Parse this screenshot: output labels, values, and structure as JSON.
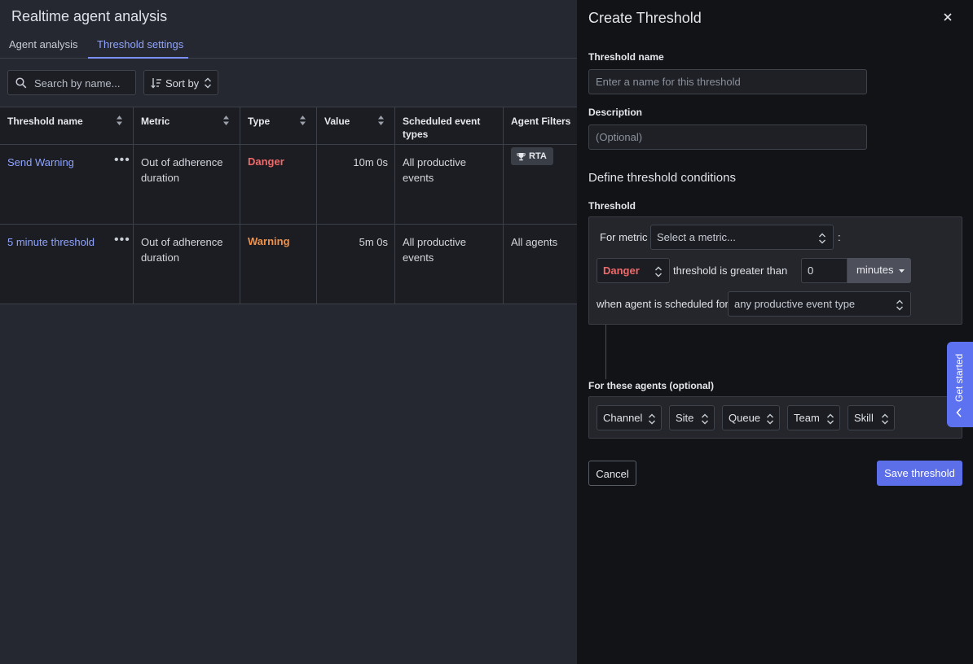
{
  "app": {
    "title": "Realtime agent analysis"
  },
  "tabs": [
    {
      "label": "Agent analysis",
      "active": false
    },
    {
      "label": "Threshold settings",
      "active": true
    }
  ],
  "toolbar": {
    "search_placeholder": "Search by name...",
    "sort_label": "Sort by"
  },
  "table": {
    "headers": {
      "name": "Threshold name",
      "metric": "Metric",
      "type": "Type",
      "value": "Value",
      "events": "Scheduled event types",
      "filters": "Agent Filters"
    },
    "rows": [
      {
        "name": "Send Warning",
        "metric": "Out of adherence duration",
        "type": "Danger",
        "value": "10m 0s",
        "events": "All productive events",
        "filter_badge": "RTA",
        "filter_icon": "trophy-icon"
      },
      {
        "name": "5 minute threshold",
        "metric": "Out of adherence duration",
        "type": "Warning",
        "value": "5m 0s",
        "events": "All productive events",
        "filters": "All agents"
      }
    ]
  },
  "panel": {
    "title": "Create Threshold",
    "name_label": "Threshold name",
    "name_placeholder": "Enter a name for this threshold",
    "description_label": "Description",
    "description_placeholder": "(Optional)",
    "conditions_title": "Define threshold conditions",
    "threshold_label": "Threshold",
    "for_metric_text": "For metric",
    "metric_placeholder": "Select a metric...",
    "colon": ":",
    "level_value": "Danger",
    "greater_than_text": "threshold is greater than",
    "amount_value": "0",
    "unit_value": "minutes",
    "scheduled_for_text": "when agent is scheduled for",
    "event_type_value": "any productive event type",
    "agents_label": "For these agents (optional)",
    "filters": [
      "Channel",
      "Site",
      "Queue",
      "Team",
      "Skill"
    ],
    "cancel_label": "Cancel",
    "save_label": "Save threshold",
    "get_started_label": "Get started"
  },
  "colors": {
    "accent": "#5c6fe8",
    "link": "#8fa4ff",
    "danger": "#ef6a6a",
    "warning": "#f0924a"
  }
}
